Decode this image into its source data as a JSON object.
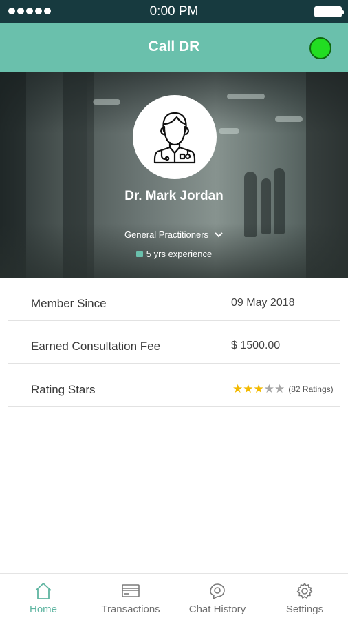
{
  "status_bar": {
    "time": "0:00 PM"
  },
  "app_bar": {
    "title": "Call DR",
    "online_color": "#22dd22"
  },
  "profile": {
    "avatar_icon": "doctor-icon",
    "name": "Dr. Mark Jordan",
    "specialty": "General Practitioners",
    "experience": "5 yrs experience"
  },
  "details": {
    "member_since": {
      "label": "Member Since",
      "value": "09 May 2018"
    },
    "consultation_fee": {
      "label": "Earned Consultation Fee",
      "value": "$ 1500.00"
    },
    "rating": {
      "label": "Rating Stars",
      "stars": 3,
      "max_stars": 5,
      "count_text": "(82 Ratings)"
    }
  },
  "tabs": [
    {
      "label": "Home",
      "icon": "home-icon",
      "active": true
    },
    {
      "label": "Transactions",
      "icon": "card-icon",
      "active": false
    },
    {
      "label": "Chat History",
      "icon": "chat-icon",
      "active": false
    },
    {
      "label": "Settings",
      "icon": "gear-icon",
      "active": false
    }
  ],
  "colors": {
    "status_bar": "#173a3f",
    "header": "#6ac0ac",
    "accent": "#5fb5a1",
    "star_on": "#f2b900",
    "star_off": "#a7a7a7"
  }
}
